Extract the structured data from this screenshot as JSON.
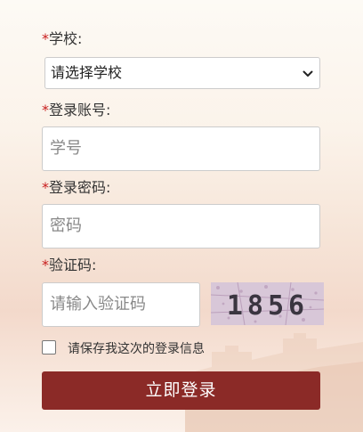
{
  "form": {
    "school": {
      "required_mark": "*",
      "label": "学校:",
      "selected": "请选择学校"
    },
    "account": {
      "required_mark": "*",
      "label": "登录账号:",
      "placeholder": "学号"
    },
    "password": {
      "required_mark": "*",
      "label": "登录密码:",
      "placeholder": "密码"
    },
    "captcha": {
      "required_mark": "*",
      "label": "验证码:",
      "placeholder": "请输入验证码",
      "image_text": "1856"
    },
    "remember": {
      "label": "请保存我这次的登录信息",
      "checked": false
    },
    "submit_label": "立即登录"
  },
  "colors": {
    "required": "#c81d1d",
    "button": "#8b2a27"
  }
}
